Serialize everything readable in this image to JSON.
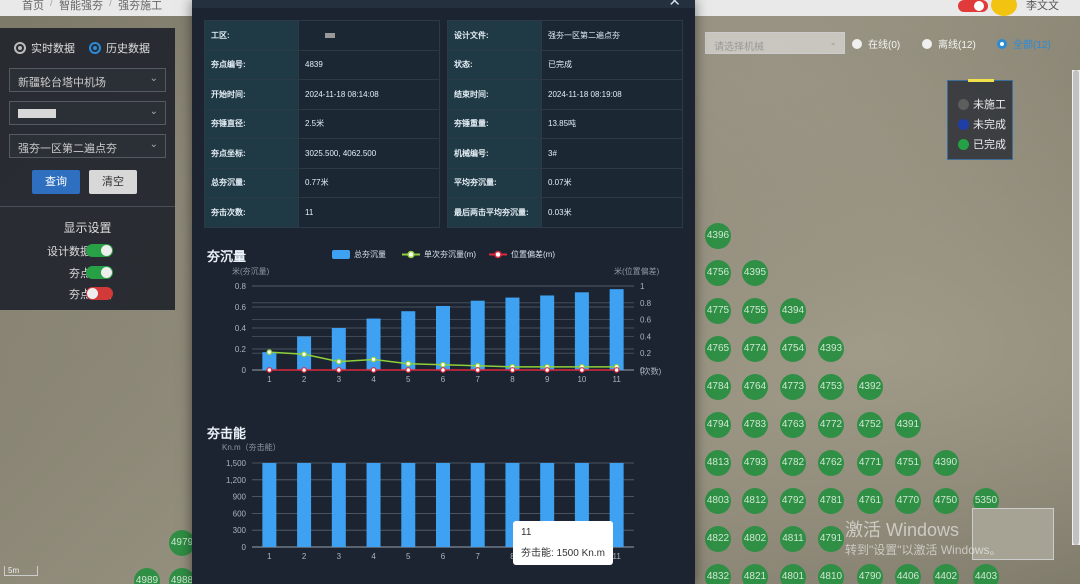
{
  "topbar": {
    "crumbs": [
      "首页",
      "/",
      "智能强夯",
      "/",
      "强夯施工"
    ],
    "user_name": "李文文"
  },
  "left_panel": {
    "radio_realtime": "实时数据",
    "radio_history": "历史数据",
    "select_project": "新疆轮台塔中机场",
    "select_area": "",
    "select_design": "强夯一区第二遍点夯",
    "btn_query": "查询",
    "btn_clear": "清空",
    "display_title": "显示设置",
    "settings": [
      {
        "label": "设计数据边界",
        "state": "on"
      },
      {
        "label": "夯点编号",
        "state": "on"
      },
      {
        "label": "夯点聚合",
        "state": "off"
      }
    ]
  },
  "filter_bar": {
    "machine_placeholder": "请选择机械",
    "online": "在线(0)",
    "offline": "离线(12)",
    "all": "全部(12)"
  },
  "legend": {
    "items": [
      {
        "label": "未施工",
        "color": "#5d5d5d"
      },
      {
        "label": "未完成",
        "color": "#1f3fa8"
      },
      {
        "label": "已完成",
        "color": "#26a044"
      }
    ]
  },
  "map_points": [
    {
      "id": "4396"
    },
    {
      "id": "4756"
    },
    {
      "id": "4395"
    },
    {
      "id": "4775"
    },
    {
      "id": "4755"
    },
    {
      "id": "4394"
    },
    {
      "id": "4765"
    },
    {
      "id": "4774"
    },
    {
      "id": "4754"
    },
    {
      "id": "4393"
    },
    {
      "id": "4784"
    },
    {
      "id": "4764"
    },
    {
      "id": "4773"
    },
    {
      "id": "4753"
    },
    {
      "id": "4392"
    },
    {
      "id": "4794"
    },
    {
      "id": "4783"
    },
    {
      "id": "4763"
    },
    {
      "id": "4772"
    },
    {
      "id": "4752"
    },
    {
      "id": "4391"
    },
    {
      "id": "4813"
    },
    {
      "id": "4793"
    },
    {
      "id": "4782"
    },
    {
      "id": "4762"
    },
    {
      "id": "4771"
    },
    {
      "id": "4751"
    },
    {
      "id": "4390"
    },
    {
      "id": "4803"
    },
    {
      "id": "4812"
    },
    {
      "id": "4792"
    },
    {
      "id": "4781"
    },
    {
      "id": "4761"
    },
    {
      "id": "4770"
    },
    {
      "id": "4750"
    },
    {
      "id": "5350"
    },
    {
      "id": "4822"
    },
    {
      "id": "4802"
    },
    {
      "id": "4811"
    },
    {
      "id": "4791"
    },
    {
      "id": "4832"
    },
    {
      "id": "4821"
    },
    {
      "id": "4801"
    },
    {
      "id": "4810"
    },
    {
      "id": "4790"
    },
    {
      "id": "4406"
    },
    {
      "id": "4402"
    },
    {
      "id": "4403"
    },
    {
      "id": "4979"
    },
    {
      "id": "4989"
    },
    {
      "id": "4988"
    }
  ],
  "watermark": {
    "line1": "激活 Windows",
    "line2": "转到\"设置\"以激活 Windows。"
  },
  "scale_label": "5m",
  "modal": {
    "close_label": "✕",
    "left_rows": [
      {
        "label": "工区:",
        "value": ""
      },
      {
        "label": "夯点编号:",
        "value": "4839"
      },
      {
        "label": "开始时间:",
        "value": "2024-11-18 08:14:08"
      },
      {
        "label": "夯锤直径:",
        "value": "2.5米"
      },
      {
        "label": "夯点坐标:",
        "value": "3025.500, 4062.500"
      },
      {
        "label": "总夯沉量:",
        "value": "0.77米"
      },
      {
        "label": "夯击次数:",
        "value": "11"
      }
    ],
    "right_rows": [
      {
        "label": "设计文件:",
        "value": "强夯一区第二遍点夯"
      },
      {
        "label": "状态:",
        "value": "已完成"
      },
      {
        "label": "结束时间:",
        "value": "2024-11-18 08:19:08"
      },
      {
        "label": "夯锤重量:",
        "value": "13.85吨"
      },
      {
        "label": "机械编号:",
        "value": "3#"
      },
      {
        "label": "平均夯沉量:",
        "value": "0.07米"
      },
      {
        "label": "最后两击平均夯沉量:",
        "value": "0.03米"
      }
    ],
    "settlement_title": "夯沉量",
    "energy_title": "夯击能"
  },
  "chart_data": [
    {
      "type": "bar",
      "title": "夯沉量",
      "categories": [
        "1",
        "2",
        "3",
        "4",
        "5",
        "6",
        "7",
        "8",
        "9",
        "10",
        "11"
      ],
      "xlabel": "(次数)",
      "ylabel_left": "米(夯沉量)",
      "ylabel_right": "米(位置偏差)",
      "ylim_left": [
        0,
        0.8
      ],
      "ylim_right": [
        0,
        1
      ],
      "yticks_left": [
        "0",
        "0.2",
        "0.4",
        "0.6",
        "0.8"
      ],
      "yticks_right": [
        "0",
        "0.2",
        "0.4",
        "0.6",
        "0.8",
        "1"
      ],
      "series": [
        {
          "name": "总夯沉量",
          "kind": "bar",
          "axis": "left",
          "color": "#3ea1f2",
          "values": [
            0.17,
            0.32,
            0.4,
            0.49,
            0.56,
            0.61,
            0.66,
            0.69,
            0.71,
            0.74,
            0.77
          ]
        },
        {
          "name": "单次夯沉量(m)",
          "kind": "line",
          "axis": "left",
          "color": "#8fcf3a",
          "values": [
            0.17,
            0.15,
            0.08,
            0.1,
            0.06,
            0.05,
            0.04,
            0.03,
            0.03,
            0.03,
            0.03
          ]
        },
        {
          "name": "位置偏差(m)",
          "kind": "line",
          "axis": "right",
          "color": "#e0283c",
          "values": [
            0,
            0,
            0,
            0,
            0,
            0,
            0,
            0,
            0,
            0,
            0
          ]
        }
      ]
    },
    {
      "type": "bar",
      "title": "夯击能",
      "categories": [
        "1",
        "2",
        "3",
        "4",
        "5",
        "6",
        "7",
        "8",
        "9",
        "10",
        "11"
      ],
      "ylabel": "Kn.m（夯击能）",
      "ylim": [
        0,
        1500
      ],
      "yticks": [
        "0",
        "300",
        "600",
        "900",
        "1,200",
        "1,500"
      ],
      "series": [
        {
          "name": "夯击能",
          "kind": "bar",
          "color": "#3ea1f2",
          "values": [
            1500,
            1500,
            1500,
            1500,
            1500,
            1500,
            1500,
            1500,
            1500,
            1500,
            1500
          ]
        }
      ],
      "tooltip": {
        "title": "11",
        "text": "夯击能: 1500 Kn.m"
      }
    }
  ]
}
